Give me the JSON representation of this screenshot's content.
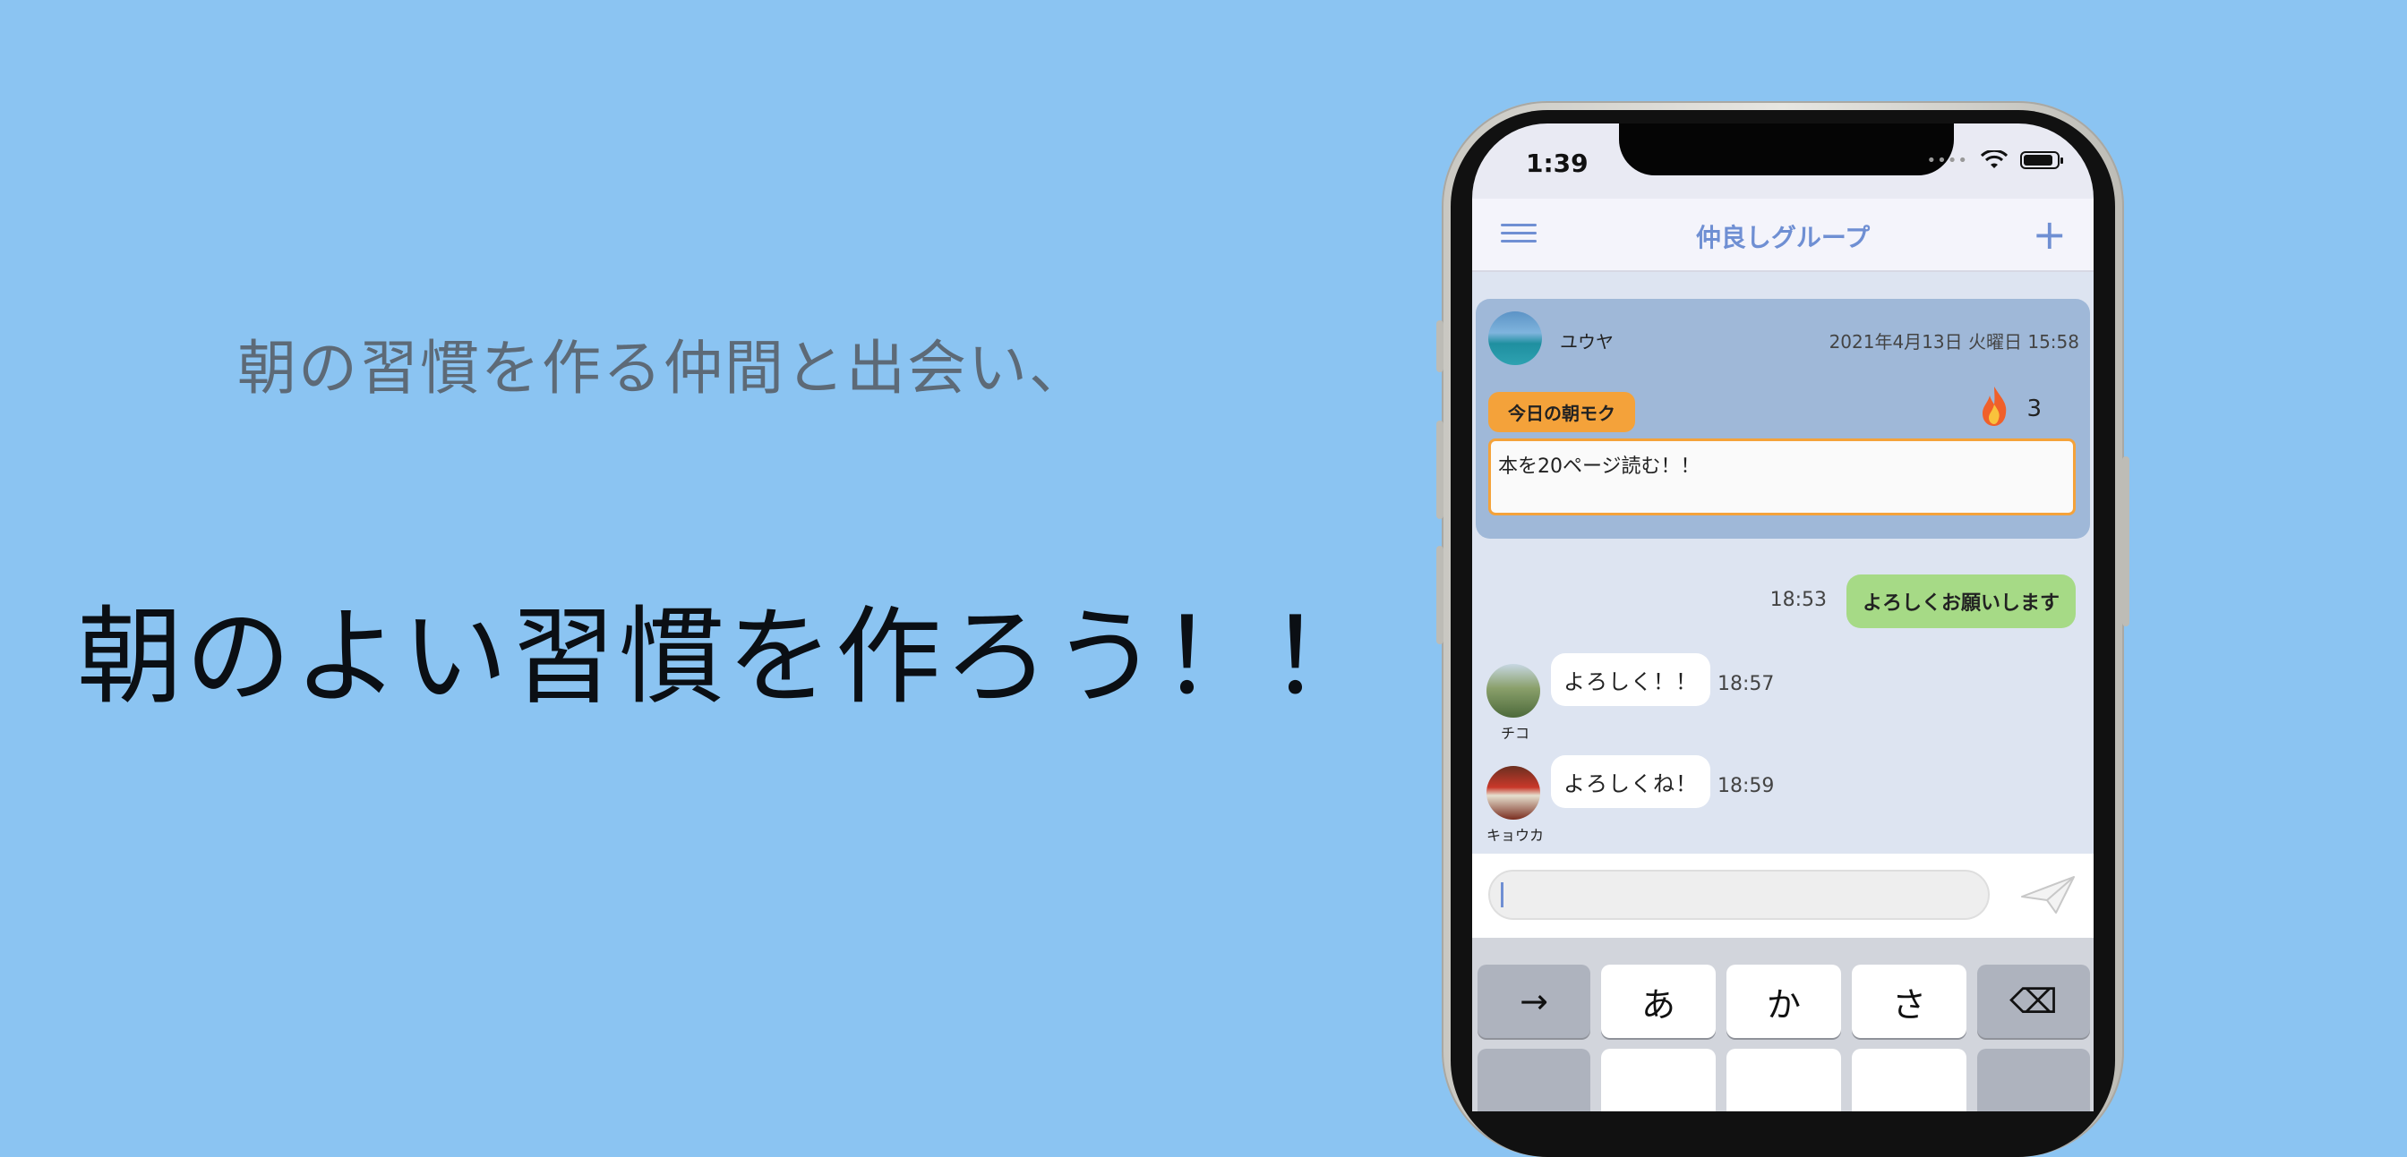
{
  "promo": {
    "subcopy": "朝の習慣を作る仲間と出会い、",
    "headline": "朝のよい習慣を作ろう！！"
  },
  "status_bar": {
    "time": "1:39"
  },
  "nav": {
    "title": "仲良しグループ"
  },
  "post": {
    "author": "ユウヤ",
    "date": "2021年4月13日 火曜日 15:58",
    "badge": "今日の朝モク",
    "streak_count": "3",
    "goal_text": "本を20ページ読む！！"
  },
  "messages": [
    {
      "sender": "me",
      "text": "よろしくお願いします",
      "time": "18:53"
    },
    {
      "sender": "チコ",
      "text": "よろしく！！",
      "time": "18:57"
    },
    {
      "sender": "キョウカ",
      "text": "よろしくね！",
      "time": "18:59"
    }
  ],
  "keyboard": {
    "keys": [
      "→",
      "あ",
      "か",
      "さ",
      "⌫"
    ]
  },
  "colors": {
    "background": "#8BC4F2",
    "accent": "#6f8fd3",
    "badge": "#f4a23a",
    "my_bubble": "#a6da86"
  }
}
